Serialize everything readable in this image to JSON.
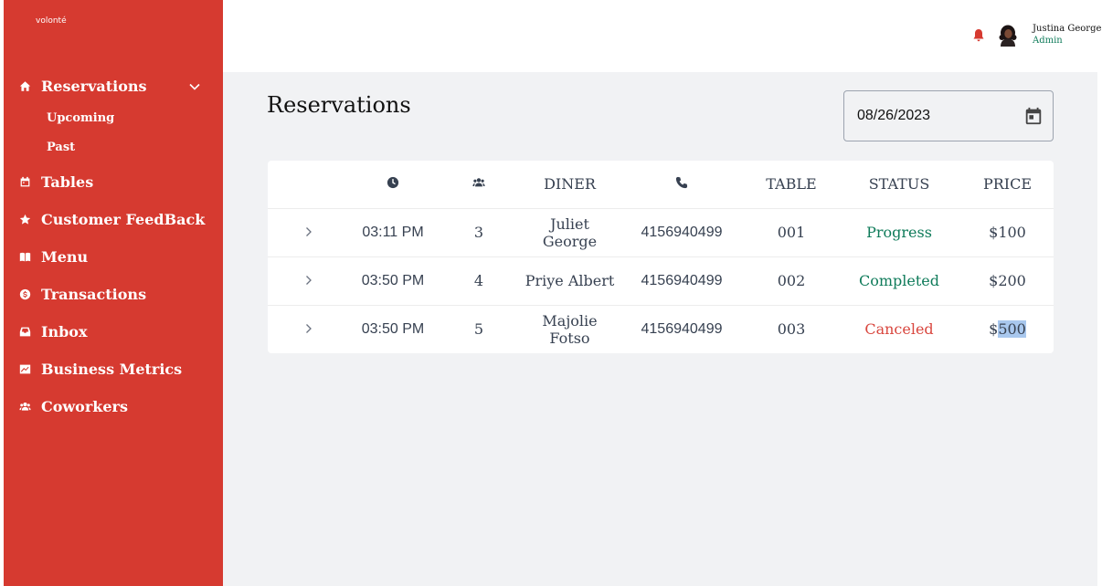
{
  "brand": "volonté",
  "sidebar": {
    "items": [
      {
        "label": "Reservations",
        "icon": "home-icon"
      },
      {
        "label": "Tables",
        "icon": "calendar-icon"
      },
      {
        "label": "Customer FeedBack",
        "icon": "star-icon"
      },
      {
        "label": "Menu",
        "icon": "book-icon"
      },
      {
        "label": "Transactions",
        "icon": "dollar-circle-icon"
      },
      {
        "label": "Inbox",
        "icon": "inbox-icon"
      },
      {
        "label": "Business Metrics",
        "icon": "chart-icon"
      },
      {
        "label": "Coworkers",
        "icon": "users-icon"
      }
    ],
    "sub_items": [
      {
        "label": "Upcoming"
      },
      {
        "label": "Past"
      }
    ]
  },
  "header": {
    "user_name": "Justina George",
    "user_role": "Admin"
  },
  "main": {
    "title": "Reservations",
    "date_value": "08/26/2023"
  },
  "table": {
    "columns": [
      "",
      "clock-icon",
      "users-icon",
      "DINER",
      "phone-icon",
      "TABLE",
      "STATUS",
      "PRICE"
    ],
    "headers": {
      "diner": "DINER",
      "table": "TABLE",
      "status": "STATUS",
      "price": "PRICE"
    },
    "rows": [
      {
        "time": "03:11 PM",
        "guests": "3",
        "diner": "Juliet George",
        "phone": "4156940499",
        "table": "001",
        "status": "Progress",
        "price_prefix": "$",
        "price_value": "100"
      },
      {
        "time": "03:50 PM",
        "guests": "4",
        "diner": "Priye Albert",
        "phone": "4156940499",
        "table": "002",
        "status": "Completed",
        "price_prefix": "$",
        "price_value": "200"
      },
      {
        "time": "03:50 PM",
        "guests": "5",
        "diner": "Majolie Fotso",
        "phone": "4156940499",
        "table": "003",
        "status": "Canceled",
        "price_prefix": "$",
        "price_value": "500"
      }
    ]
  },
  "colors": {
    "sidebar_bg": "#d63a30",
    "status_green": "#0f7b5a",
    "status_red": "#d9473f",
    "main_bg": "#f1f2f4"
  }
}
